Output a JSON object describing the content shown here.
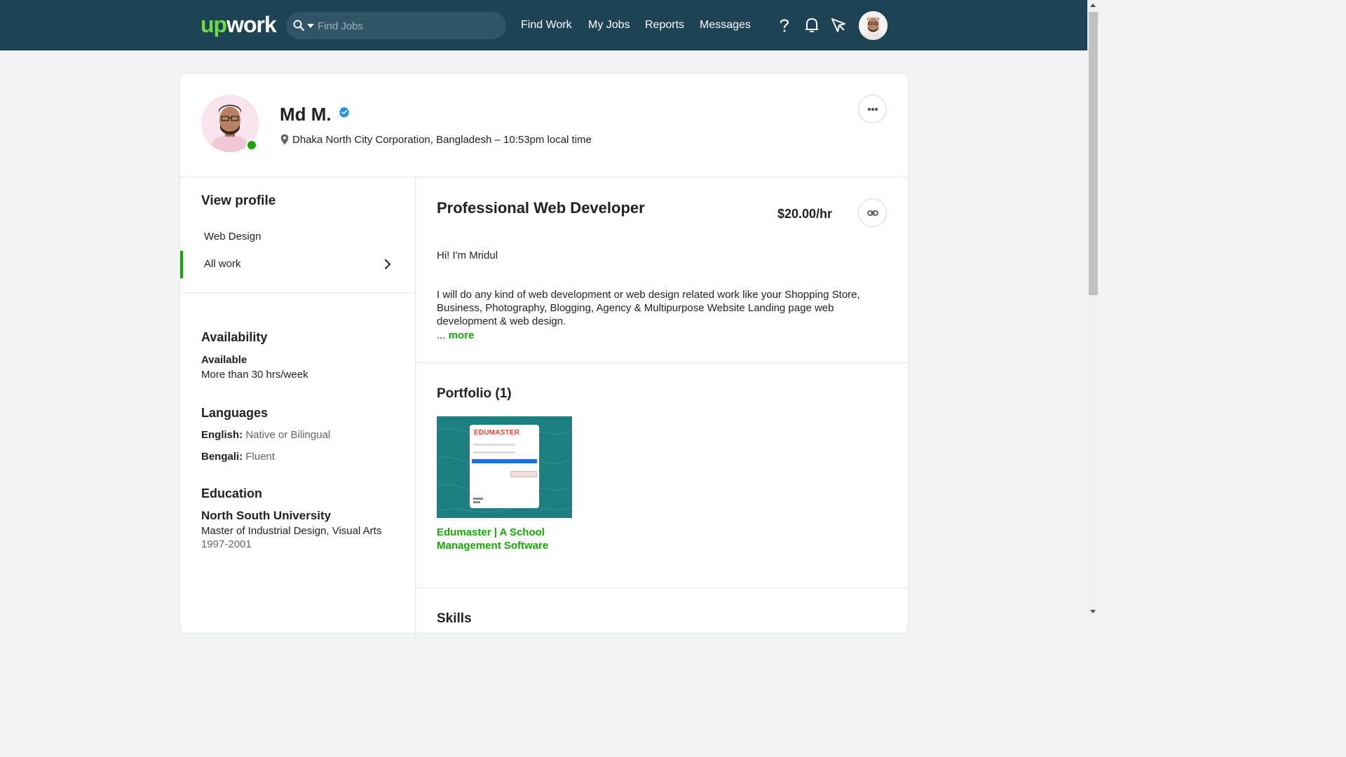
{
  "nav": {
    "logo_up": "up",
    "logo_work": "work",
    "search_placeholder": "Find Jobs",
    "links": [
      "Find Work",
      "My Jobs",
      "Reports",
      "Messages"
    ],
    "icons": [
      "help-icon",
      "notifications-icon",
      "direct-contracts-icon",
      "user-avatar"
    ]
  },
  "profile": {
    "name": "Md M.",
    "location": "Dhaka North City Corporation, Bangladesh – 10:53pm local time",
    "online": true
  },
  "sidebar": {
    "title": "View profile",
    "items": [
      {
        "label": "Web Design"
      },
      {
        "label": "All work"
      }
    ],
    "availability": {
      "title": "Availability",
      "status": "Available",
      "hours": "More than 30 hrs/week"
    },
    "languages": {
      "title": "Languages",
      "items": [
        {
          "name": "English:",
          "level": "Native or Bilingual"
        },
        {
          "name": "Bengali:",
          "level": "Fluent"
        }
      ]
    },
    "education": {
      "title": "Education",
      "school": "North South University",
      "degree": "Master of Industrial Design, Visual Arts",
      "years": "1997-2001"
    }
  },
  "main": {
    "headline": "Professional Web Developer",
    "rate": "$20.00/hr",
    "greeting": "Hi! I'm Mridul",
    "overview": "I will do any kind of web development or web design related work like your Shopping Store, Business, Photography, Blogging, Agency & Multipurpose Website Landing page web development & web design.",
    "ellipsis": "... ",
    "more_label": "more",
    "portfolio_title": "Portfolio (1)",
    "portfolio_item": "Edumaster | A School Management Software",
    "portfolio_thumb_logo": "EDUMASTER",
    "skills_title": "Skills"
  },
  "colors": {
    "nav_bg": "#1d4354",
    "brand_green": "#14a800",
    "logo_green": "#6fda44"
  }
}
